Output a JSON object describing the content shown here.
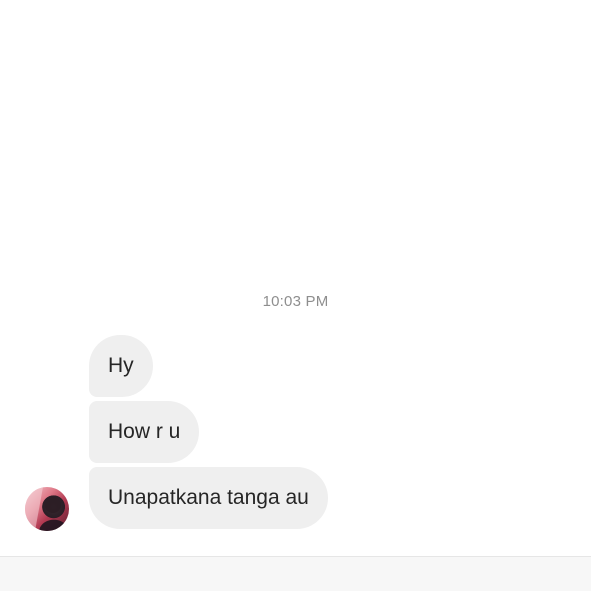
{
  "thread": {
    "timestamp": "10:03 PM",
    "messages": [
      {
        "text": "Hy"
      },
      {
        "text": "How r u"
      },
      {
        "text": "Unapatkana tanga au"
      }
    ]
  },
  "colors": {
    "bubble_background": "#efefef",
    "message_text": "#262626",
    "timestamp_text": "#8e8e8e",
    "composer_background": "#f7f7f7"
  },
  "icons": {
    "avatar": "sender-avatar-photo"
  }
}
